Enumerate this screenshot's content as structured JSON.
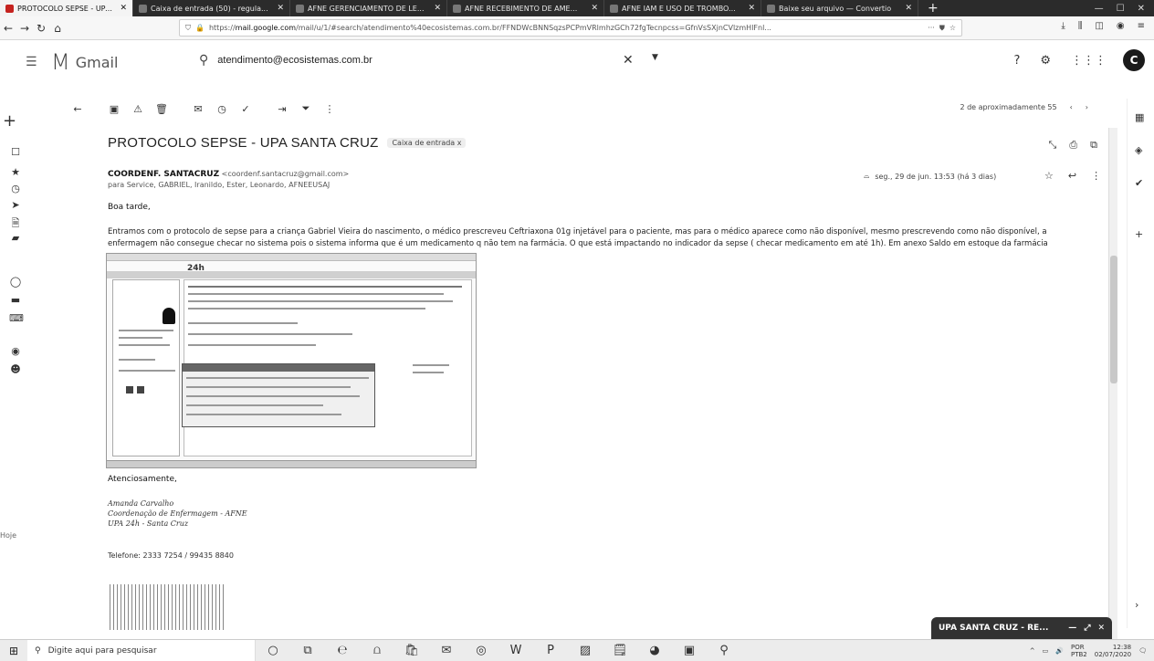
{
  "browser": {
    "tabs": [
      {
        "title": "PROTOCOLO SEPSE - UPA SAN",
        "active": true
      },
      {
        "title": "Caixa de entrada (50) - regula...",
        "active": false
      },
      {
        "title": "AFNE GERENCIAMENTO DE LE...",
        "active": false
      },
      {
        "title": "AFNE RECEBIMENTO DE AME...",
        "active": false
      },
      {
        "title": "AFNE IAM E USO DE TROMBO...",
        "active": false
      },
      {
        "title": "Baixe seu arquivo — Convertio",
        "active": false
      }
    ],
    "new_tab": "+",
    "url_prefix": "https://",
    "url_domain": "mail.google.com",
    "url_rest": "/mail/u/1/#search/atendimento%40ecosistemas.com.br/FFNDWcBNNSqzsPCPmVRlmhzGCh72fgTecnpcss=GfnVsSXjnCVlzmHlFnl..."
  },
  "gmail": {
    "app_name": "Gmail",
    "search_value": "atendimento@ecosistemas.com.br",
    "pager": "2 de aproximadamente 55"
  },
  "email": {
    "subject": "PROTOCOLO SEPSE - UPA SANTA CRUZ",
    "label": "Caixa de entrada x",
    "sender_name": "COORDENF. SANTACRUZ",
    "sender_email": "<coordenf.santacruz@gmail.com>",
    "recipients": "para Service, GABRIEL, Iranildo, Ester, Leonardo, AFNEEUSAJ",
    "date": "seg., 29 de jun. 13:53 (há 3 dias)",
    "greeting": "Boa tarde,",
    "body": "Entramos com o protocolo de sepse para a criança Gabriel Vieira do nascimento, o médico prescreveu Ceftriaxona 01g injetável para o paciente, mas para o médico aparece como não disponível, mesmo prescrevendo como não disponível, a enfermagem não consegue checar no sistema pois o sistema informa que é um medicamento q não tem na farmácia. O que está impactando no indicador da sepse ( checar medicamento em até 1h). Em anexo Saldo em estoque da farmácia",
    "attachment_title": "24h",
    "closing": "Atenciosamente,",
    "sig_name": "Amanda Carvalho",
    "sig_role": "Coordenação de Enfermagem - AFNE",
    "sig_unit": "UPA 24h - Santa Cruz",
    "phone": "Telefone: 2333 7254 / 99435 8840"
  },
  "left_rail": {
    "footer_label": "Hoje"
  },
  "chat_chip": {
    "label": "UPA SANTA CRUZ - RE..."
  },
  "taskbar": {
    "search_placeholder": "Digite aqui para pesquisar",
    "lang": "POR",
    "layout": "PTB2",
    "time": "12:38",
    "date": "02/07/2020"
  }
}
